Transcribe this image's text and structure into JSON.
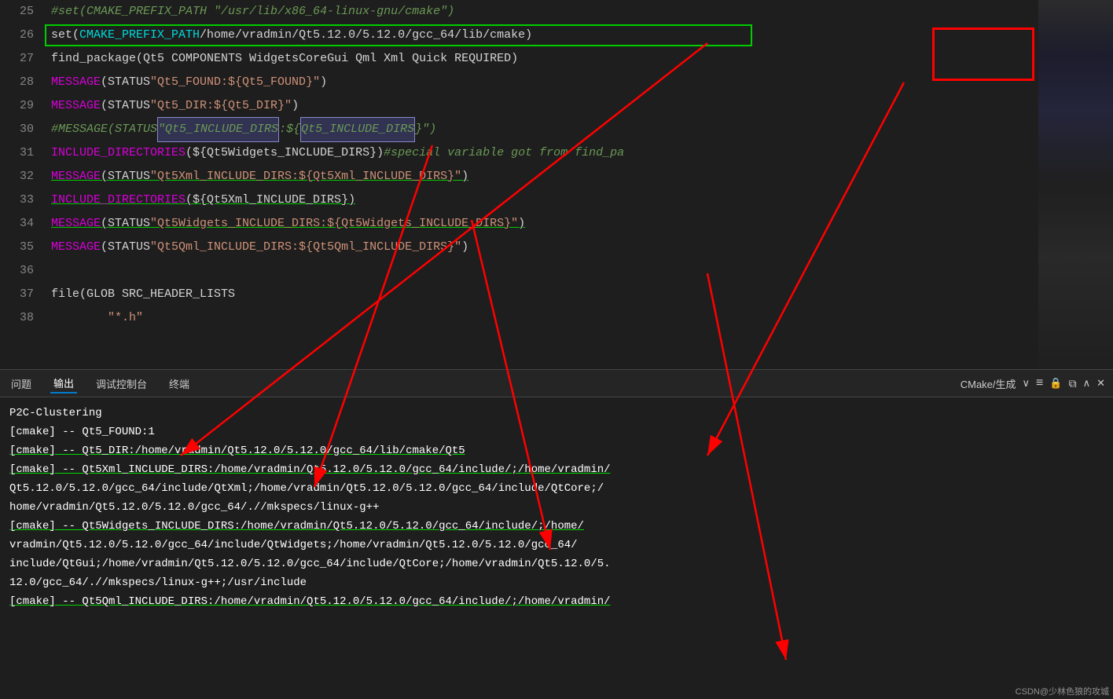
{
  "editor": {
    "lines": [
      {
        "num": 25,
        "content": "#set(CMAKE_PREFIX_PATH \"/usr/lib/x86_64-linux-gnu/cmake\")",
        "color": "gray-italic"
      },
      {
        "num": 26,
        "content": "set(CMAKE_PREFIX_PATH /home/vradmin/Qt5.12.0/5.12.0/gcc_64/lib/cmake)",
        "highlighted": true,
        "arrow": true
      },
      {
        "num": 27,
        "content": "find_package(Qt5 COMPONENTS Widgets Core Gui Qml Xml Quick REQUIRED)"
      },
      {
        "num": 28,
        "content": "MESSAGE(STATUS \"Qt5_FOUND:${Qt5_FOUND}\")",
        "underlined": false
      },
      {
        "num": 29,
        "content": "MESSAGE(STATUS \"Qt5_DIR:${Qt5_DIR}\")",
        "underlined": false
      },
      {
        "num": 30,
        "content": "#MESSAGE(STATUS \"Qt5_INCLUDE_DIRS:${Qt5_INCLUDE_DIRS}\")",
        "gray": true,
        "selection": true
      },
      {
        "num": 31,
        "content": "INCLUDE_DIRECTORIES(${Qt5Widgets_INCLUDE_DIRS}) #special variable got from find_pa"
      },
      {
        "num": 32,
        "content": "MESSAGE(STATUS \"Qt5Xml_INCLUDE_DIRS:${Qt5Xml_INCLUDE_DIRS}\")",
        "underlined": true
      },
      {
        "num": 33,
        "content": "INCLUDE_DIRECTORIES(${Qt5Xml_INCLUDE_DIRS})",
        "underlined": true
      },
      {
        "num": 34,
        "content": "MESSAGE(STATUS \"Qt5Widgets_INCLUDE_DIRS:${Qt5Widgets_INCLUDE_DIRS}\")",
        "underlined": true
      },
      {
        "num": 35,
        "content": "MESSAGE(STATUS \"Qt5Qml_INCLUDE_DIRS:${Qt5Qml_INCLUDE_DIRS}\")",
        "underlined": false
      },
      {
        "num": 36,
        "content": ""
      },
      {
        "num": 37,
        "content": "file(GLOB SRC_HEADER_LISTS"
      },
      {
        "num": 38,
        "content": "        \"*.h\""
      }
    ]
  },
  "terminal": {
    "tabs": [
      "问题",
      "输出",
      "调试控制台",
      "终端"
    ],
    "active_tab": "输出",
    "dropdown_label": "CMake/生成",
    "output_lines": [
      "P2C-Clustering",
      "[cmake]  --  Qt5_FOUND:1",
      "[cmake]  --  Qt5_DIR:/home/vradmin/Qt5.12.0/5.12.0/gcc_64/lib/cmake/Qt5",
      "[cmake]  --  Qt5Xml_INCLUDE_DIRS:/home/vradmin/Qt5.12.0/5.12.0/gcc_64/include/;/home/vradmin/",
      "Qt5.12.0/5.12.0/gcc_64/include/QtXml;/home/vradmin/Qt5.12.0/5.12.0/gcc_64/include/QtCore;/",
      "home/vradmin/Qt5.12.0/5.12.0/gcc_64/.//mkspecs/linux-g++",
      "[cmake]  --  Qt5Widgets_INCLUDE_DIRS:/home/vradmin/Qt5.12.0/5.12.0/gcc_64/include/;/home/",
      "vradmin/Qt5.12.0/5.12.0/gcc_64/include/QtWidgets;/home/vradmin/Qt5.12.0/5.12.0/gcc_64/",
      "include/QtGui;/home/vradmin/Qt5.12.0/5.12.0/gcc_64/include/QtCore;/home/vradmin/Qt5.12.0/5.",
      "12.0/gcc_64/.//mkspecs/linux-g++;/usr/include",
      "[cmake]  --  Qt5Qml_INCLUDE_DIRS:/home/vradmin/Qt5.12.0/5.12.0/gcc_64/include/;/home/vradmin/"
    ]
  },
  "watermark": "CSDN@少林色狼的攻城"
}
